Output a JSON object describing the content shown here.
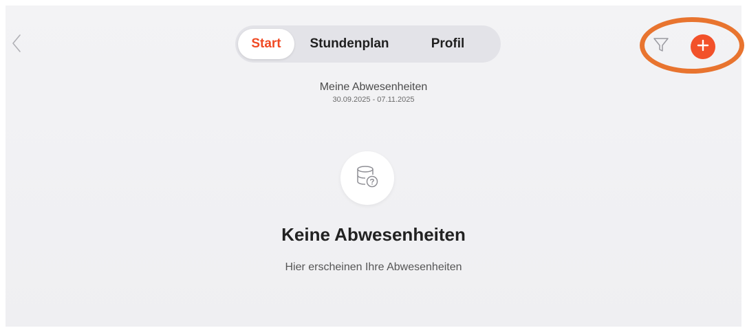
{
  "header": {
    "tabs": [
      {
        "label": "Start",
        "active": true
      },
      {
        "label": "Stundenplan",
        "active": false
      },
      {
        "label": "Profil",
        "active": false
      }
    ],
    "icons": {
      "back": "chevron-left-icon",
      "filter": "filter-icon",
      "add": "plus-icon"
    }
  },
  "section": {
    "title": "Meine Abwesenheiten",
    "date_range": "30.09.2025 - 07.11.2025"
  },
  "empty_state": {
    "icon": "database-question-icon",
    "title": "Keine Abwesenheiten",
    "subtitle": "Hier erscheinen Ihre Abwesenheiten"
  },
  "colors": {
    "accent": "#f04a24",
    "highlight": "#e8742f",
    "background": "#f1f1f4"
  }
}
